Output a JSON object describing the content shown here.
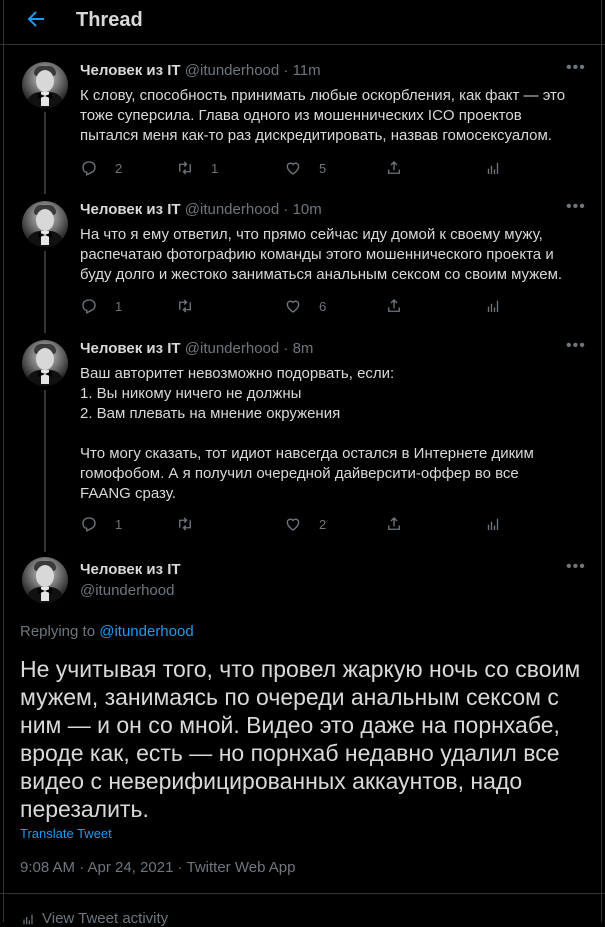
{
  "header": {
    "title": "Thread",
    "back_icon": "arrow-left-icon",
    "accent": "#1d9bf0"
  },
  "author": {
    "name": "Человек из IT",
    "handle": "@itunderhood"
  },
  "tweets": [
    {
      "time": "11m",
      "text": "К слову, способность принимать любые оскорбления, как факт — это\nтоже суперсила. Глава одного из мошеннических ICO проектов\nпытался меня как-то раз дискредитировать, назвав гомосексуалом.",
      "replies": "2",
      "retweets": "1",
      "likes": "5"
    },
    {
      "time": "10m",
      "text": "На что я ему ответил, что прямо сейчас иду домой к своему мужу,\nраспечатаю фотографию команды этого мошеннического проекта и\nбуду долго и жестоко заниматься анальным сексом со своим мужем.",
      "replies": "1",
      "retweets": "",
      "likes": "6"
    },
    {
      "time": "8m",
      "text": "Ваш авторитет невозможно подорвать, если:\n1. Вы никому ничего не должны\n2. Вам плевать на мнение окружения\n\nЧто могу сказать, тот идиот навсегда остался в Интернете диким\nгомофобом. А я получил очередной дайверсити-оффер во все\nFAANG сразу.",
      "replies": "1",
      "retweets": "",
      "likes": "2"
    }
  ],
  "main": {
    "replying_prefix": "Replying to",
    "replying_handle": "@itunderhood",
    "text": "Не учитывая того, что провел жаркую ночь со своим\nмужем, занимаясь по очереди анальным сексом с\nним — и он со мной. Видео это даже на порнхабе,\nвроде как, есть — но порнхаб недавно удалил все\nвидео с неверифицированных аккаунтов, надо\nперезалить.",
    "translate": "Translate Tweet",
    "timestamp": "9:08 AM · Apr 24, 2021 · Twitter Web App",
    "activity": "View Tweet activity"
  }
}
